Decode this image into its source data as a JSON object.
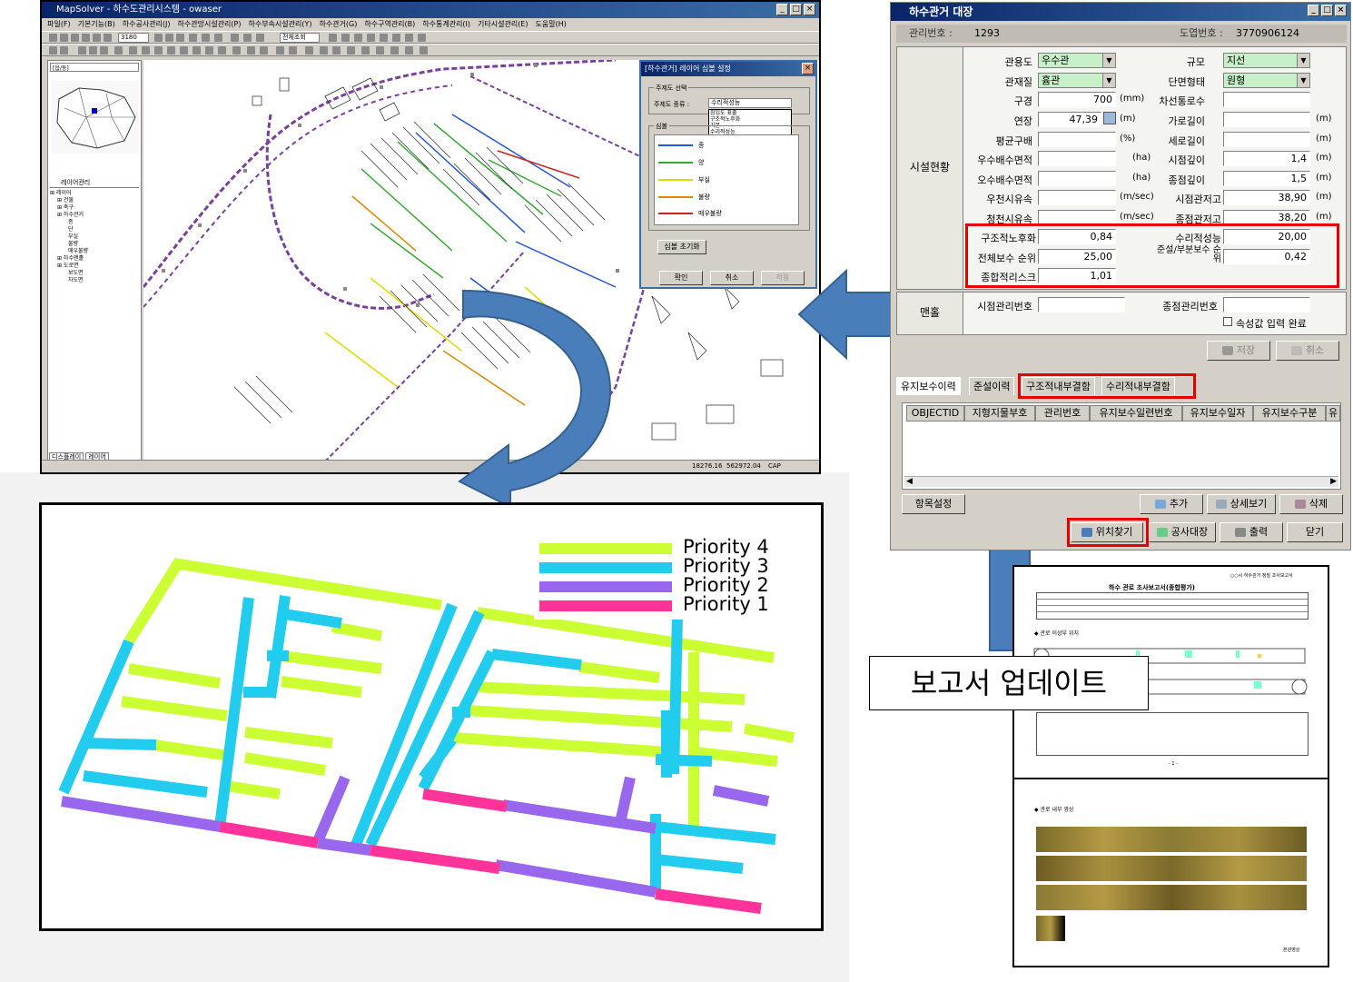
{
  "map_window": {
    "title": "MapSolver - 하수도관리시스템 - owaser",
    "menu": [
      "파일(F)",
      "기본기능(B)",
      "하수공사관리(J)",
      "하수관망시설관리(P)",
      "하수부속시설관리(Y)",
      "하수관거(G)",
      "하수구역관리(B)",
      "하수통계관리(I)",
      "기타시설관리(E)",
      "도움말(H)"
    ],
    "scale": "3180",
    "zoom_combo": "전체조회",
    "region_combo": "[읍/동]",
    "layer_tab": "레이어관리",
    "layers": [
      "레이어",
      "건물",
      "",
      "축구",
      "",
      "하수관거",
      "종",
      "단",
      "부실",
      "불량",
      "매우불량",
      "하수맨홀",
      "도로면",
      "보도면",
      "차도면"
    ],
    "bottom_tabs": [
      "디스플레이",
      "레이어"
    ],
    "status": [
      "18276.16",
      "562972.04",
      "CAP"
    ]
  },
  "symbol_dialog": {
    "title": "[하수관거] 레이어 심볼 설정",
    "group_theme": "주제도 선택",
    "theme_label": "주제도 종류 :",
    "theme_value": "수리적성능",
    "options": [
      "침입도 표출",
      "구조적노후화",
      "기본",
      "수리적성능",
      "전체보수 우선순위",
      "종합리스크",
      "준설/유지보수 우선순위"
    ],
    "group_symbol": "심볼",
    "legend": [
      "종",
      "양",
      "부실",
      "불량",
      "매우불량"
    ],
    "init_button": "심볼 초기화",
    "ok": "확인",
    "cancel": "취소",
    "apply": "적용"
  },
  "property_window": {
    "title": "하수관거 대장",
    "mgmt_no_label": "관리번호 :",
    "mgmt_no": "1293",
    "map_no_label": "도엽번호 :",
    "map_no": "3770906124",
    "section_facility": "시설현황",
    "section_manhole": "맨홀",
    "fields": {
      "use_label": "관용도",
      "use": "우수관",
      "material_label": "관재질",
      "material": "흄관",
      "diameter_label": "구경",
      "diameter": "700",
      "diameter_unit": "(mm)",
      "length_label": "연장",
      "length": "47,39",
      "length_unit": "(m)",
      "slope_label": "평균구배",
      "slope_unit": "(%)",
      "rain_area_label": "우수배수면적",
      "rain_area_unit": "(ha)",
      "sewage_area_label": "오수배수면적",
      "sewage_area_unit": "(ha)",
      "rain_flow_label": "우천시유속",
      "rain_flow_unit": "(m/sec)",
      "dry_flow_label": "청천시유속",
      "dry_flow_unit": "(m/sec)",
      "scale_label": "규모",
      "scale": "지선",
      "shape_label": "단면형태",
      "shape": "원형",
      "lanes_label": "차선통로수",
      "width_label": "가로길이",
      "width_unit": "(m)",
      "height_label": "세로길이",
      "height_unit": "(m)",
      "start_depth_label": "시점깊이",
      "start_depth": "1,4",
      "start_depth_unit": "(m)",
      "end_depth_label": "종점깊이",
      "end_depth": "1,5",
      "end_depth_unit": "(m)",
      "start_elev_label": "시점관저고",
      "start_elev": "38,90",
      "start_elev_unit": "(m)",
      "end_elev_label": "종점관저고",
      "end_elev": "38,20",
      "end_elev_unit": "(m)"
    },
    "risk": {
      "structural_label": "구조적노후화",
      "structural": "0,84",
      "hydraulic_label": "수리적성능",
      "hydraulic": "20,00",
      "overall_label": "전체보수 순위",
      "overall": "25,00",
      "dredge_label": "준설/부분보수 순위",
      "dredge": "0,42",
      "risk_label": "종합적리스크",
      "risk": "1,01"
    },
    "start_mh_label": "시점관리번호",
    "end_mh_label": "종점관리번호",
    "attr_done": "속성값 입력 완료",
    "save": "저장",
    "cancel": "취소",
    "tabs": [
      "유지보수이력",
      "준설이력",
      "구조적내부결함",
      "수리적내부결함"
    ],
    "grid_headers": [
      "OBJECTID",
      "지형지물부호",
      "관리번호",
      "유지보수일련번호",
      "유지보수일자",
      "유지보수구분",
      "유"
    ],
    "item_setting": "항목설정",
    "add": "추가",
    "detail": "상세보기",
    "delete": "삭제",
    "locate": "위치찾기",
    "construction": "공사대장",
    "print": "출력",
    "close": "닫기"
  },
  "diagram": {
    "legend": [
      {
        "label": "Priority 4",
        "color": "#ccff33"
      },
      {
        "label": "Priority 3",
        "color": "#22ccee"
      },
      {
        "label": "Priority 2",
        "color": "#9966ee"
      },
      {
        "label": "Priority 1",
        "color": "#ff3399"
      }
    ]
  },
  "update_label": "보고서 업데이트",
  "report": {
    "top_header": "○○시 하수관거 정밀 조사보고서",
    "title": "하수 관로 조사보고서(종합평가)",
    "section1": "◆ 관로 이상부 위치",
    "section2": "◆ 관로 내부 영상",
    "page": "- 1 -",
    "caption": "본관영상"
  }
}
